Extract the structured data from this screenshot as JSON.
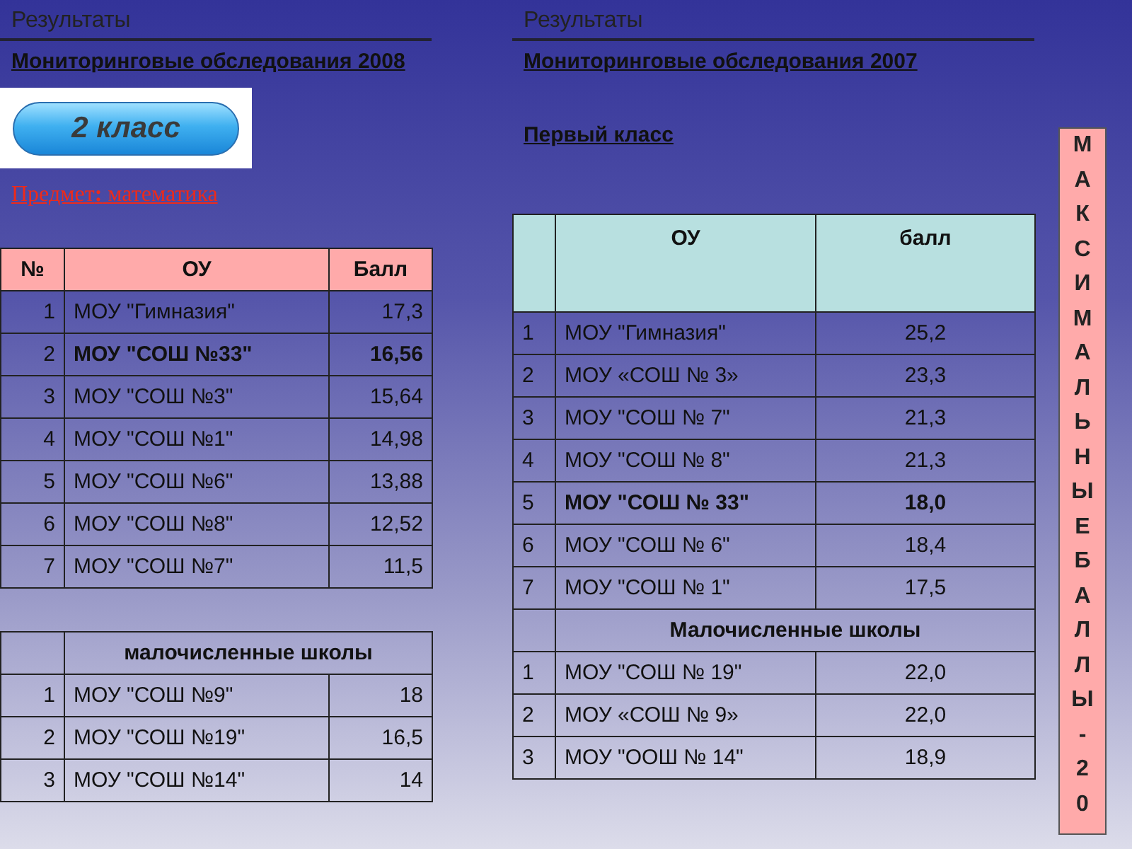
{
  "left": {
    "section_label": "Результаты",
    "title": "Мониторинговые обследования 2008",
    "grade_badge": "2 класс",
    "subject": "Предмет**:** математика",
    "table": {
      "columns": [
        "№",
        "ОУ",
        "Балл"
      ],
      "rows": [
        {
          "kind": "data",
          "cells": [
            "1",
            "МОУ \"Гимназия\"",
            "17,3"
          ],
          "bold": false
        },
        {
          "kind": "data",
          "cells": [
            "2",
            "МОУ \"СОШ №33\"",
            "16,56"
          ],
          "bold": true
        },
        {
          "kind": "data",
          "cells": [
            "3",
            "МОУ \"СОШ №3\"",
            "15,64"
          ],
          "bold": false
        },
        {
          "kind": "data",
          "cells": [
            "4",
            "МОУ \"СОШ №1\"",
            "14,98"
          ],
          "bold": false
        },
        {
          "kind": "data",
          "cells": [
            "5",
            "МОУ \"СОШ №6\"",
            "13,88"
          ],
          "bold": false
        },
        {
          "kind": "data",
          "cells": [
            "6",
            "МОУ \"СОШ №8\"",
            "12,52"
          ],
          "bold": false
        },
        {
          "kind": "data",
          "cells": [
            "7",
            "МОУ \"СОШ №7\"",
            "11,5"
          ],
          "bold": false
        }
      ]
    },
    "small_schools_table": {
      "rows": [
        {
          "kind": "group",
          "title": "малочисленные школы"
        },
        {
          "kind": "data",
          "cells": [
            "1",
            "МОУ \"СОШ №9\"",
            "18"
          ],
          "bold": false
        },
        {
          "kind": "data",
          "cells": [
            "2",
            "МОУ \"СОШ №19\"",
            "16,5"
          ],
          "bold": false
        },
        {
          "kind": "data",
          "cells": [
            "3",
            "МОУ \"СОШ №14\"",
            "14"
          ],
          "bold": false
        }
      ]
    }
  },
  "right": {
    "section_label": "Результаты",
    "title": "Мониторинговые обследования 2007",
    "subtitle": "Первый класс",
    "table": {
      "columns": [
        "ОУ",
        "балл"
      ],
      "rows": [
        {
          "kind": "data",
          "cells": [
            "1",
            "МОУ \"Гимназия\"",
            "25,2"
          ],
          "bold": false
        },
        {
          "kind": "data",
          "cells": [
            "2",
            "МОУ  «СОШ № 3»",
            "23,3"
          ],
          "bold": false
        },
        {
          "kind": "data",
          "cells": [
            "3",
            "МОУ \"СОШ № 7\"",
            "21,3"
          ],
          "bold": false
        },
        {
          "kind": "data",
          "cells": [
            "4",
            "МОУ \"СОШ № 8\"",
            "21,3"
          ],
          "bold": false
        },
        {
          "kind": "data",
          "cells": [
            "5",
            "МОУ \"СОШ № 33\"",
            "18,0"
          ],
          "bold": true
        },
        {
          "kind": "data",
          "cells": [
            "6",
            "МОУ \"СОШ № 6\"",
            "18,4"
          ],
          "bold": false
        },
        {
          "kind": "data",
          "cells": [
            "7",
            "МОУ \"СОШ № 1\"",
            "17,5"
          ],
          "bold": false
        },
        {
          "kind": "group",
          "title": "Малочисленные школы"
        },
        {
          "kind": "data",
          "cells": [
            "1",
            "МОУ \"СОШ № 19\"",
            "22,0"
          ],
          "bold": false
        },
        {
          "kind": "data",
          "cells": [
            "2",
            "МОУ «СОШ № 9»",
            "22,0"
          ],
          "bold": false
        },
        {
          "kind": "data",
          "cells": [
            "3",
            "МОУ \"ООШ № 14\"",
            "18,9"
          ],
          "bold": false
        }
      ]
    }
  },
  "banner": {
    "text": "МАКСИМАЛЬНЫЕ БАЛЛЫ - 20"
  }
}
